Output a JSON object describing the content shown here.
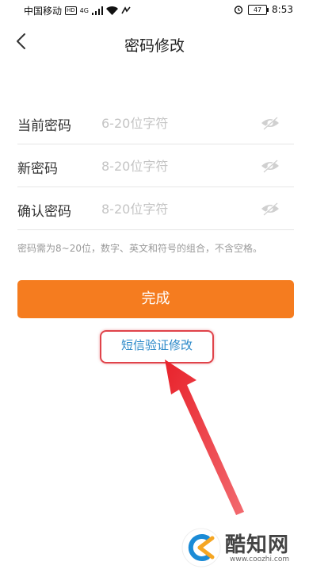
{
  "statusbar": {
    "carrier": "中国移动",
    "hd": "HD",
    "network": "4G",
    "battery": "47",
    "time": "8:53"
  },
  "header": {
    "title": "密码修改",
    "back_icon": "chevron-left-icon"
  },
  "form": {
    "fields": [
      {
        "label": "当前密码",
        "placeholder": "6-20位字符"
      },
      {
        "label": "新密码",
        "placeholder": "8-20位字符"
      },
      {
        "label": "确认密码",
        "placeholder": "8-20位字符"
      }
    ],
    "hint": "密码需为8~20位，数字、英文和符号的组合，不含空格。"
  },
  "submit_label": "完成",
  "sms_link": "短信验证修改",
  "colors": {
    "accent": "#f57c1f",
    "link": "#2a88c8",
    "annotation": "#e0434a"
  },
  "watermark": {
    "text": "酷知网",
    "url": "www.coozhi.com"
  }
}
